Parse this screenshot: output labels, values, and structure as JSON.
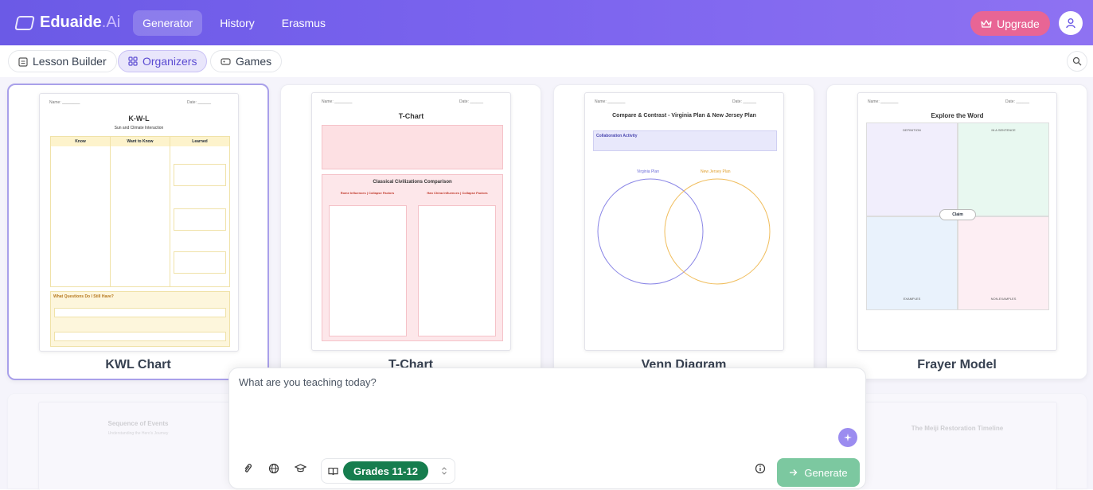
{
  "app": {
    "name_main": "Eduaide",
    "name_suffix": ".Ai"
  },
  "nav": {
    "tabs": [
      {
        "label": "Generator"
      },
      {
        "label": "History"
      },
      {
        "label": "Erasmus"
      }
    ]
  },
  "header": {
    "upgrade_label": "Upgrade"
  },
  "subnav": {
    "items": [
      {
        "label": "Lesson Builder"
      },
      {
        "label": "Organizers"
      },
      {
        "label": "Games"
      }
    ]
  },
  "cards": [
    {
      "title": "KWL Chart",
      "preview": {
        "title": "K-W-L",
        "subtitle": "Sun and Climate Interaction",
        "columns": [
          "Know",
          "Want to Know",
          "Learned"
        ],
        "footer_title": "What Questions Do I Still Have?"
      }
    },
    {
      "title": "T-Chart",
      "preview": {
        "title": "T-Chart",
        "section_title": "Classical Civilizations Comparison",
        "left_header": "Rome Influences | Collapse Factors",
        "right_header": "Han China Influences | Collapse Factors"
      }
    },
    {
      "title": "Venn Diagram",
      "preview": {
        "title": "Compare & Contrast - Virginia Plan & New Jersey Plan",
        "activity": "Collaboration Activity",
        "left_label": "Virginia Plan",
        "right_label": "New Jersey Plan"
      }
    },
    {
      "title": "Frayer Model",
      "preview": {
        "title": "Explore the Word",
        "q1": "DEFINITION",
        "q2": "IN A SENTENCE",
        "q3": "EXAMPLES",
        "q4": "NON-EXAMPLES",
        "center": "Claim"
      }
    }
  ],
  "row2": {
    "left_title": "Sequence of Events",
    "left_sub": "Understanding the Hero's Journey",
    "right_title": "The Meiji Restoration Timeline"
  },
  "composer": {
    "placeholder": "What are you teaching today?",
    "grade_label": "Grades 11-12",
    "generate_label": "Generate"
  },
  "colors": {
    "brand": "#7a63ee",
    "upgrade": "#e86595",
    "grade": "#167d4e",
    "generate": "#7cc8a0"
  }
}
